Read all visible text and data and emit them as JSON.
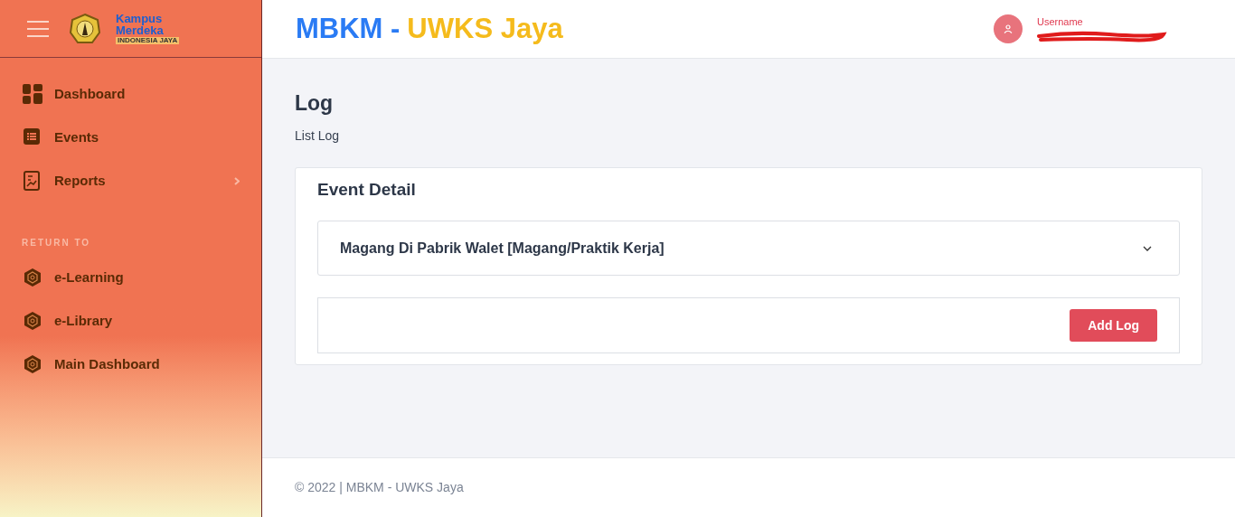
{
  "sidebar": {
    "logo": {
      "line1": "Kampus",
      "line2": "Merdeka",
      "tagline": "INDONESIA JAYA"
    },
    "items": [
      {
        "label": "Dashboard",
        "kind": "grid",
        "has_submenu": false
      },
      {
        "label": "Events",
        "kind": "list",
        "has_submenu": false
      },
      {
        "label": "Reports",
        "kind": "report",
        "has_submenu": true
      }
    ],
    "section_title": "RETURN TO",
    "links": [
      {
        "label": "e-Learning"
      },
      {
        "label": "e-Library"
      },
      {
        "label": "Main Dashboard"
      }
    ]
  },
  "header": {
    "title_left": "MBKM -",
    "title_right": "UWKS Jaya",
    "user_label": "Username"
  },
  "page": {
    "title": "Log",
    "subtitle": "List Log"
  },
  "card": {
    "title": "Event Detail",
    "accordion": {
      "label": "Magang Di Pabrik Walet [Magang/Praktik Kerja]",
      "expanded": false
    },
    "button": "Add Log"
  },
  "footer": "© 2022 | MBKM - UWKS Jaya"
}
